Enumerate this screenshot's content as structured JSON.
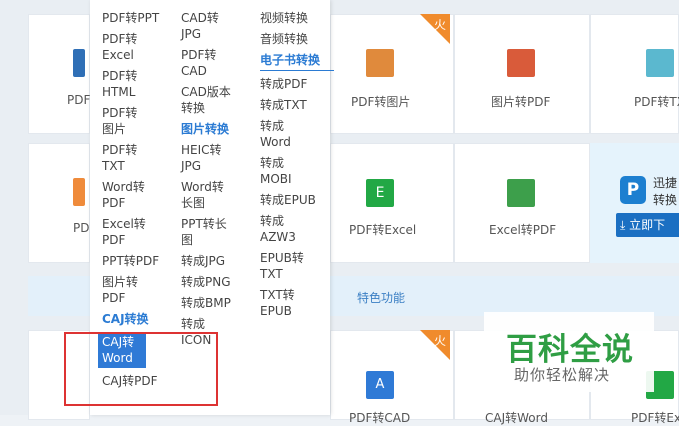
{
  "colors": {
    "accent": "#2f7ad6",
    "hot_tag": "#f08b2c",
    "highlight_box": "#dd3333",
    "watermark_green": "#2f9e44"
  },
  "grid_row1": [
    {
      "label": "PDF",
      "icon": "pdf-icon",
      "color": "#2f6fb6"
    },
    {
      "label": "PDF转图片",
      "icon": "image-icon",
      "color": "#e08a3c"
    },
    {
      "label": "图片转PDF",
      "icon": "pdf-icon",
      "color": "#d95b3a"
    },
    {
      "label": "PDF转TX",
      "icon": "text-icon",
      "color": "#5bb8cf"
    }
  ],
  "grid_row2": [
    {
      "label": "PD",
      "icon": "pdf-icon",
      "color": "#ef8b3b"
    },
    {
      "label": "PDF转Excel",
      "icon": "excel-icon",
      "color": "#22a845"
    },
    {
      "label": "Excel转PDF",
      "icon": "excel-pdf-icon",
      "color": "#3d9f4b"
    }
  ],
  "grid_row3": [
    {
      "label": "PDF转CAD"
    },
    {
      "label": "CAJ转Word"
    },
    {
      "label": "PDF转Ex"
    }
  ],
  "hot_tag": "火",
  "promo": {
    "line1": "迅捷",
    "line2": "转换",
    "button": "立即下"
  },
  "section_title": "特色功能",
  "menu": {
    "col1": [
      "PDF转PPT",
      "PDF转Excel",
      "PDF转HTML",
      "PDF转图片",
      "PDF转TXT",
      "Word转PDF",
      "Excel转PDF",
      "PPT转PDF",
      "图片转PDF"
    ],
    "col1_heading": "CAJ转换",
    "col1_selected": "CAJ转Word",
    "col1_after": "CAJ转PDF",
    "col2": [
      "CAD转JPG",
      "PDF转CAD",
      "CAD版本转换"
    ],
    "col2_heading": "图片转换",
    "col2_after": [
      "HEIC转JPG",
      "Word转长图",
      "PPT转长图",
      "转成JPG",
      "转成PNG",
      "转成BMP",
      "转成ICON"
    ],
    "col3": [
      "视频转换",
      "音频转换"
    ],
    "col3_heading": "电子书转换",
    "col3_after": [
      "转成PDF",
      "转成TXT",
      "转成Word",
      "转成MOBI",
      "转成EPUB",
      "转成AZW3",
      "EPUB转TXT",
      "TXT转EPUB"
    ]
  },
  "watermark": {
    "title": "百科全说",
    "subtitle": "助你轻松解决"
  }
}
